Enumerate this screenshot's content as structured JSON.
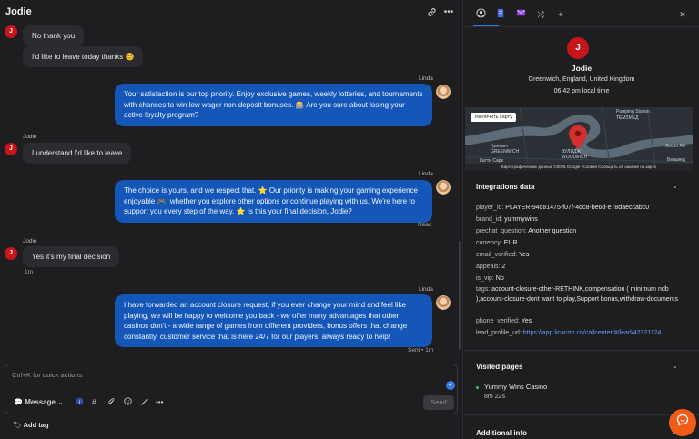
{
  "header": {
    "title": "Jodie"
  },
  "messages": {
    "m1": "No thank you",
    "m2": "I'd like to leave today thanks 😊",
    "agent_name_1": "Linda",
    "m3": "Your satisfaction is our top priority. Enjoy exclusive games, weekly lotteries, and tournaments with chances to win low wager non-deposit bonuses. 🎰 Are you sure about losing your active loyalty program?",
    "jodie_name_1": "Jodie",
    "m4": "I understand I'd like to leave",
    "agent_name_2": "Linda",
    "m5": "The choice is yours, and we respect that. ⭐ Our priority is making your gaming experience enjoyable 🎮, whether you explore other options or continue playing with us. We're here to support you every step of the way. ⭐ Is this your final decision, Jodie?",
    "m5_status": "Read",
    "jodie_name_2": "Jodie",
    "m6": "Yes it's my final decision",
    "m6_time": "1m",
    "agent_name_3": "Linda",
    "m7": "I have forwarded an account closure request, if you ever change your mind and feel like playing, we will be happy to welcome you back - we offer many advantages that other casinos don't - a wide range of games from different providers, bonus offers that change constantly, customer service that is here 24/7 for our players, always ready to help!",
    "m7_status": "Sent • 1m"
  },
  "composer": {
    "placeholder": "Ctrl+K for quick actions",
    "message_label": "Message",
    "send_label": "Send",
    "add_tag_label": "Add tag"
  },
  "profile": {
    "initial": "J",
    "name": "Jodie",
    "location": "Greenwich, England, United Kingdom",
    "local_time": "06:42 pm local time"
  },
  "map": {
    "enlarge": "Увеличить карту",
    "labels": [
      "Pumping Station",
      "Гринвич GREENWICH",
      "Катти Сарк",
      "ВУЛИДЖ WOOLWICH",
      "Бельвед",
      "Лесно Аб",
      "ТЕМЗМЕД"
    ],
    "footer": "Картографические данные ©2025 Google   Условия   Сообщить об ошибке на карте"
  },
  "integrations": {
    "title": "Integrations data",
    "player_id": "PLAYER-94d81475-f07f-4dc8-be6d-e78daeccabc0",
    "brand_id": "yummywins",
    "prechat_question": "Another question",
    "currency": "EUR",
    "email_verified": "Yes",
    "appeals": "2",
    "is_vip": "No",
    "tags": "account-closure-other-RETHINK,compensation ( minimum ndb ),account-closure-dont want to play,Support bonus,withdraw-documents",
    "phone_verified": "Yes",
    "lead_profile_url": "https://app.licacrm.co/callcenter/#/lead/42321124"
  },
  "visited": {
    "title": "Visited pages",
    "page": "Yummy Wins Casino",
    "time": "8m 22s"
  },
  "additional": {
    "title": "Additional info"
  }
}
